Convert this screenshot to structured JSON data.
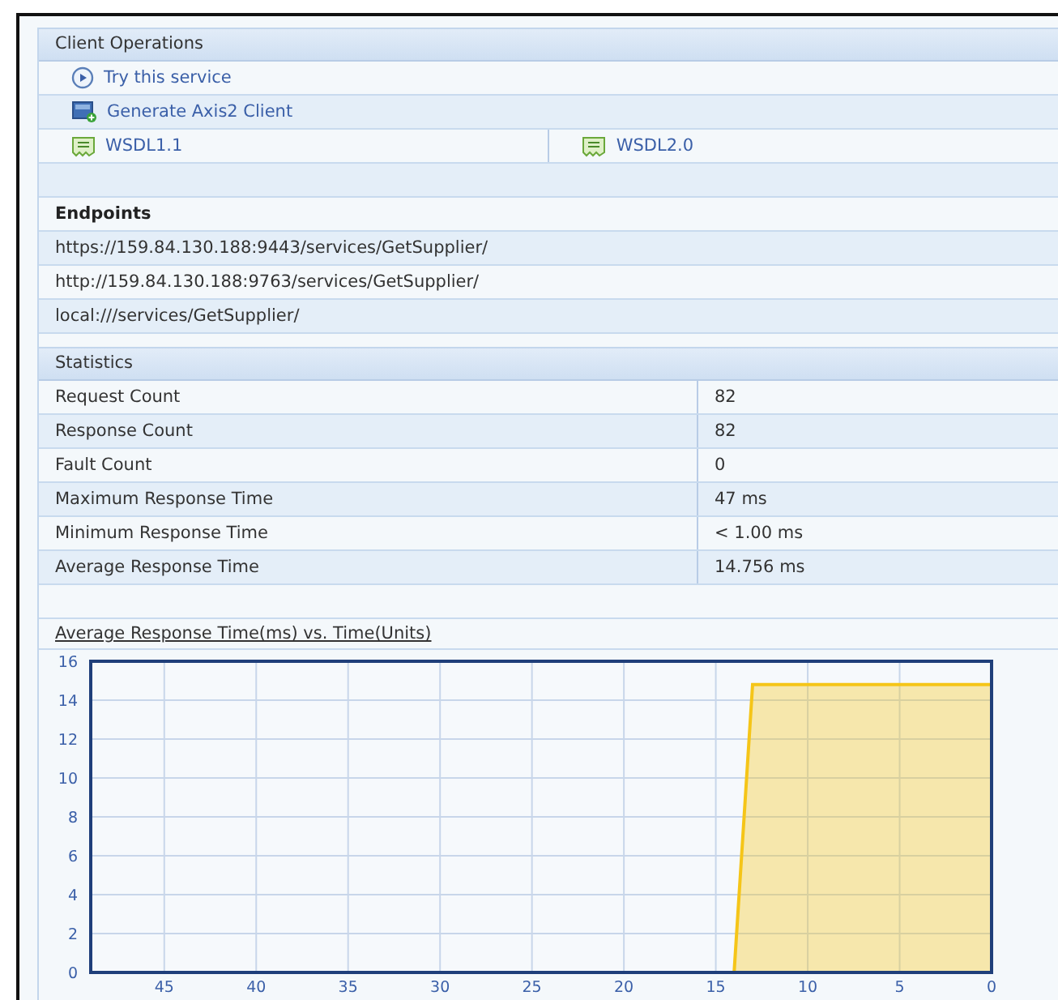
{
  "client_operations": {
    "title": "Client Operations",
    "actions": [
      {
        "label": "Try this service"
      },
      {
        "label": "Generate Axis2 Client"
      }
    ],
    "wsdl_links": [
      "WSDL1.1",
      "WSDL2.0"
    ]
  },
  "endpoints": {
    "title": "Endpoints",
    "urls": [
      "https://159.84.130.188:9443/services/GetSupplier/",
      "http://159.84.130.188:9763/services/GetSupplier/",
      "local:///services/GetSupplier/"
    ]
  },
  "statistics": {
    "title": "Statistics",
    "rows": [
      {
        "label": "Request Count",
        "value": "82"
      },
      {
        "label": "Response Count",
        "value": "82"
      },
      {
        "label": "Fault Count",
        "value": "0"
      },
      {
        "label": "Maximum Response Time",
        "value": "47 ms"
      },
      {
        "label": "Minimum Response Time",
        "value": "< 1.00 ms"
      },
      {
        "label": "Average Response Time",
        "value": "14.756 ms"
      }
    ]
  },
  "graph": {
    "title": "Average Response Time(ms) vs. Time(Units)",
    "chart_data": {
      "type": "area",
      "x": [
        49,
        48,
        47,
        46,
        45,
        44,
        43,
        42,
        41,
        40,
        39,
        38,
        37,
        36,
        35,
        34,
        33,
        32,
        31,
        30,
        29,
        28,
        27,
        26,
        25,
        24,
        23,
        22,
        21,
        20,
        19,
        18,
        17,
        16,
        15,
        14,
        13,
        12,
        11,
        10,
        9,
        8,
        7,
        6,
        5,
        4,
        3,
        2,
        1,
        0
      ],
      "series": [
        {
          "color": "#f5c518",
          "values": [
            0,
            0,
            0,
            0,
            0,
            0,
            0,
            0,
            0,
            0,
            0,
            0,
            0,
            0,
            0,
            0,
            0,
            0,
            0,
            0,
            0,
            0,
            0,
            0,
            0,
            0,
            0,
            0,
            0,
            0,
            0,
            0,
            0,
            0,
            0,
            0,
            14.8,
            14.8,
            14.8,
            14.8,
            14.8,
            14.8,
            14.8,
            14.8,
            14.8,
            14.8,
            14.8,
            14.8,
            14.8,
            14.8
          ]
        }
      ],
      "grid": true,
      "xlim": [
        49,
        0
      ],
      "ylim": [
        0,
        16
      ],
      "xticks": [
        45,
        40,
        35,
        30,
        25,
        20,
        15,
        10,
        5,
        0
      ],
      "yticks": [
        0,
        2,
        4,
        6,
        8,
        10,
        12,
        14,
        16
      ]
    }
  }
}
